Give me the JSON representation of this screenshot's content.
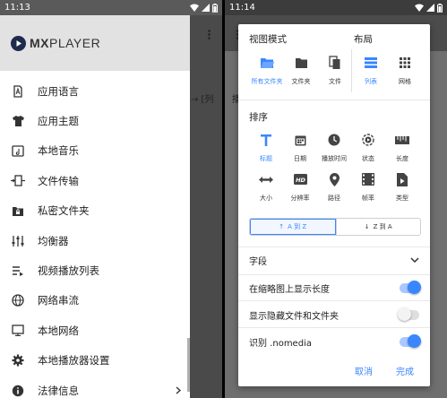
{
  "left_screen": {
    "status": {
      "time": "11:13"
    },
    "logo": {
      "mx": "MX",
      "player": "PLAYER"
    },
    "menu": [
      {
        "label": "应用语言",
        "icon": "language-icon"
      },
      {
        "label": "应用主题",
        "icon": "tshirt-icon"
      },
      {
        "label": "本地音乐",
        "icon": "music-folder-icon"
      },
      {
        "label": "文件传输",
        "icon": "file-transfer-icon"
      },
      {
        "label": "私密文件夹",
        "icon": "lock-folder-icon"
      },
      {
        "label": "均衡器",
        "icon": "equalizer-icon"
      },
      {
        "label": "视频播放列表",
        "icon": "playlist-icon"
      },
      {
        "label": "网络串流",
        "icon": "globe-icon"
      },
      {
        "label": "本地网络",
        "icon": "monitor-icon"
      },
      {
        "label": "本地播放器设置",
        "icon": "gear-icon"
      },
      {
        "label": "法律信息",
        "icon": "info-icon"
      }
    ],
    "behind_text": "→ [列"
  },
  "right_screen": {
    "status": {
      "time": "11:14"
    },
    "behind_text": "播",
    "dialog": {
      "view_mode_title": "视图模式",
      "view_mode_options": [
        {
          "label": "所有文件夹",
          "selected": true,
          "icon": "folder-open-icon"
        },
        {
          "label": "文件夹",
          "selected": false,
          "icon": "folder-icon"
        },
        {
          "label": "文件",
          "selected": false,
          "icon": "files-icon"
        }
      ],
      "layout_title": "布局",
      "layout_options": [
        {
          "label": "列表",
          "selected": true,
          "icon": "list-icon"
        },
        {
          "label": "网格",
          "selected": false,
          "icon": "grid-icon"
        }
      ],
      "sort_title": "排序",
      "sort_options": [
        {
          "label": "标题",
          "selected": true,
          "icon": "title-icon"
        },
        {
          "label": "日期",
          "selected": false,
          "icon": "calendar-icon"
        },
        {
          "label": "播放时间",
          "selected": false,
          "icon": "clock-icon"
        },
        {
          "label": "状态",
          "selected": false,
          "icon": "status-icon"
        },
        {
          "label": "长度",
          "selected": false,
          "icon": "ruler-icon"
        },
        {
          "label": "大小",
          "selected": false,
          "icon": "resize-icon"
        },
        {
          "label": "分辨率",
          "selected": false,
          "icon": "hd-icon"
        },
        {
          "label": "路径",
          "selected": false,
          "icon": "location-icon"
        },
        {
          "label": "帧率",
          "selected": false,
          "icon": "film-icon"
        },
        {
          "label": "类型",
          "selected": false,
          "icon": "file-type-icon"
        }
      ],
      "sort_direction": {
        "asc_label": "A 到 Z",
        "desc_label": "Z 到 A",
        "selected": "asc"
      },
      "fields_label": "字段",
      "settings": [
        {
          "label": "在缩略图上显示长度",
          "on": true
        },
        {
          "label": "显示隐藏文件和文件夹",
          "on": false
        },
        {
          "label": "识别 .nomedia",
          "on": true
        }
      ],
      "cancel_label": "取消",
      "done_label": "完成"
    }
  },
  "colors": {
    "accent": "#3a86ff",
    "accent_light": "#a9c8ff",
    "drawer_header": "#e2e2e2",
    "scrim": "#6f6f6f"
  }
}
